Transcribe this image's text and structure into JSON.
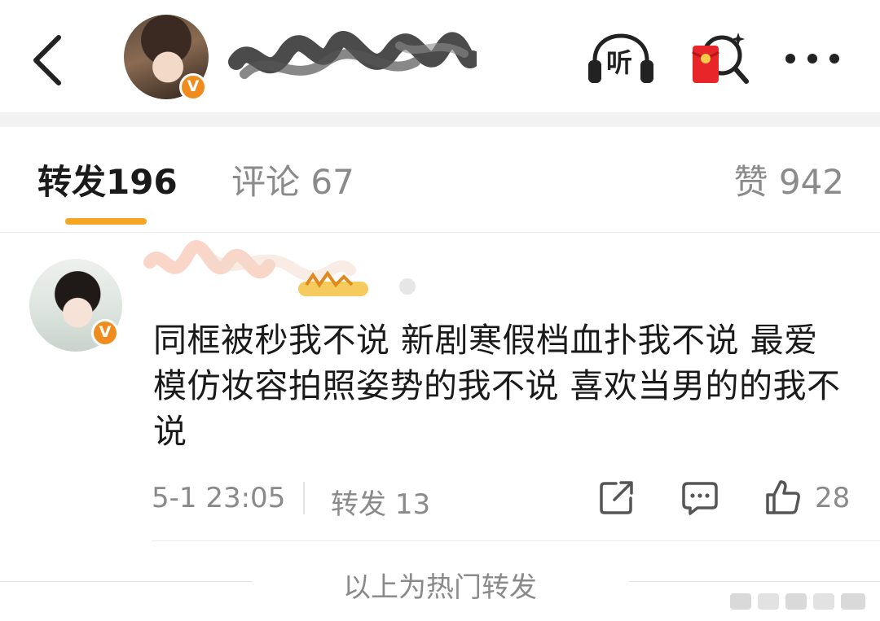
{
  "header": {
    "back_icon": "chevron-left-icon",
    "listen_label": "听",
    "listen_icon": "headphones-icon",
    "redpack_icon": "red-envelope-search-icon",
    "more_icon": "more-dots-icon",
    "verified_mark": "V"
  },
  "tabs": [
    {
      "label": "转发",
      "count": "196",
      "active": true
    },
    {
      "label": "评论",
      "count": "67",
      "active": false
    },
    {
      "label": "赞",
      "count": "942",
      "active": false
    }
  ],
  "colors": {
    "accent": "#f5a623",
    "verified": "#f08c1e",
    "muted_text": "#8a8a8a",
    "body_text": "#1a1a1a"
  },
  "repost": {
    "verified_mark": "V",
    "text": "同框被秒我不说 新剧寒假档血扑我不说 最爱模仿妆容拍照姿势的我不说 喜欢当男的的我不说",
    "time": "5-1 23:05",
    "repost_label": "转发",
    "repost_count": "13",
    "like_count": "28"
  },
  "footer": {
    "note": "以上为热门转发"
  }
}
